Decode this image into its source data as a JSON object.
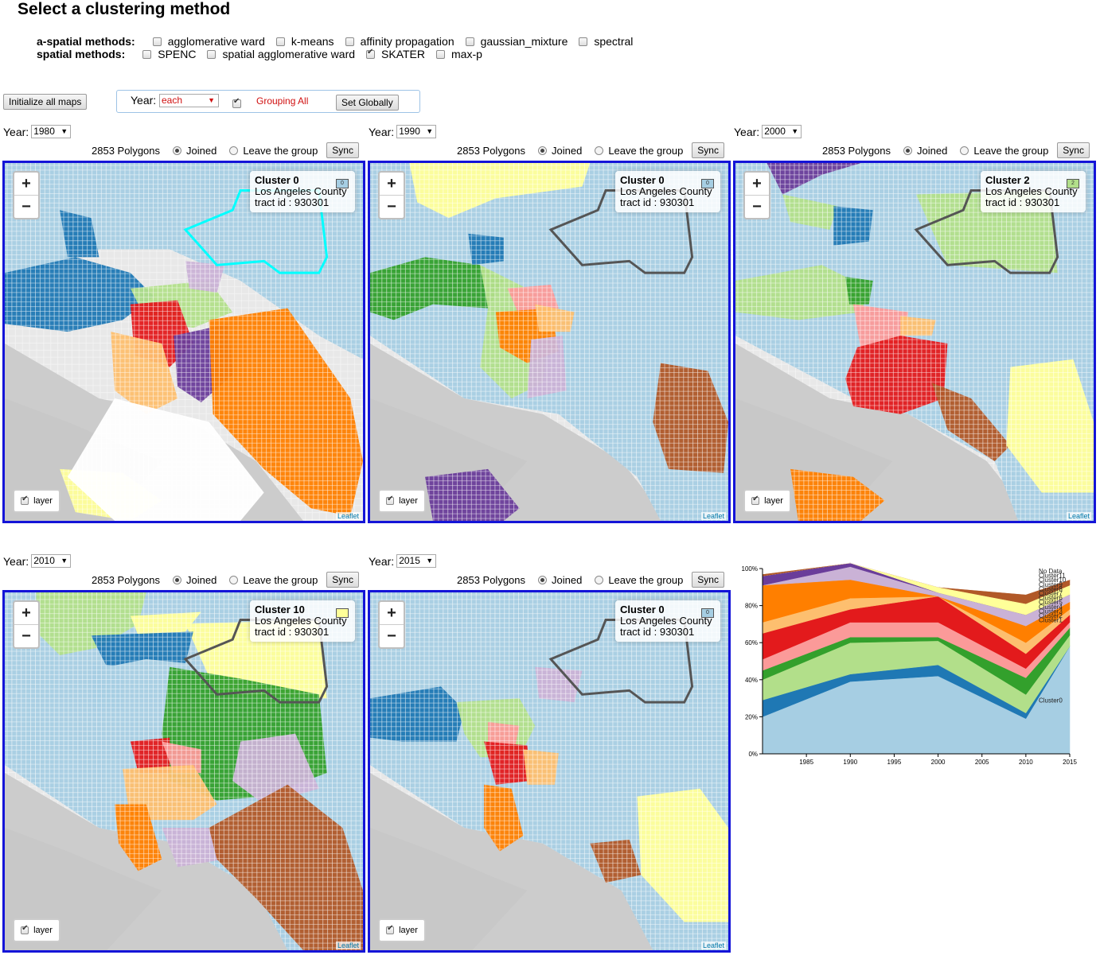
{
  "page_title": "Select a clustering method",
  "aspatial": {
    "label": "a-spatial methods:",
    "options": [
      {
        "label": "agglomerative ward",
        "checked": false
      },
      {
        "label": "k-means",
        "checked": false
      },
      {
        "label": "affinity propagation",
        "checked": false
      },
      {
        "label": "gaussian_mixture",
        "checked": false
      },
      {
        "label": "spectral",
        "checked": false
      }
    ]
  },
  "spatial": {
    "label": "spatial methods:",
    "options": [
      {
        "label": "SPENC",
        "checked": false
      },
      {
        "label": "spatial agglomerative ward",
        "checked": false
      },
      {
        "label": "SKATER",
        "checked": true
      },
      {
        "label": "max-p",
        "checked": false
      }
    ]
  },
  "init_button": "Initialize all maps",
  "global": {
    "year_label": "Year:",
    "year_value": "each",
    "grouping_label": "Grouping All",
    "grouping_checked": true,
    "set_button": "Set Globally"
  },
  "common": {
    "year_label": "Year:",
    "polygons": "2853 Polygons",
    "joined": "Joined",
    "leave": "Leave the group",
    "sync": "Sync",
    "zoom_in": "+",
    "zoom_out": "−",
    "layer": "layer",
    "attribution": "Leaflet"
  },
  "maps": [
    {
      "year": "1980",
      "cluster": "Cluster 0",
      "swatch_label": "0",
      "swatch_color": "#a6cee3",
      "county": "Los Angeles County",
      "tract": "tract id : 930301"
    },
    {
      "year": "1990",
      "cluster": "Cluster 0",
      "swatch_label": "0",
      "swatch_color": "#a6cee3",
      "county": "Los Angeles County",
      "tract": "tract id : 930301"
    },
    {
      "year": "2000",
      "cluster": "Cluster 2",
      "swatch_label": "2",
      "swatch_color": "#b2df8a",
      "county": "Los Angeles County",
      "tract": "tract id : 930301"
    },
    {
      "year": "2010",
      "cluster": "Cluster 10",
      "swatch_label": "",
      "swatch_color": "#ffff99",
      "county": "Los Angeles County",
      "tract": "tract id : 930301"
    },
    {
      "year": "2015",
      "cluster": "Cluster 0",
      "swatch_label": "0",
      "swatch_color": "#a6cee3",
      "county": "Los Angeles County",
      "tract": "tract id : 930301"
    }
  ],
  "chart_data": {
    "type": "area",
    "stacked": true,
    "x": [
      1980,
      1990,
      2000,
      2010,
      2015
    ],
    "x_ticks": [
      "1985",
      "1990",
      "1995",
      "2000",
      "2005",
      "2010",
      "2015"
    ],
    "y_ticks": [
      "0%",
      "20%",
      "40%",
      "60%",
      "80%",
      "100%"
    ],
    "ylim": [
      0,
      100
    ],
    "series": [
      {
        "name": "Cluster0",
        "color": "#a6cee3",
        "values": [
          20,
          39,
          42,
          19,
          58
        ]
      },
      {
        "name": "Cluster1",
        "color": "#1f78b4",
        "values": [
          9,
          4,
          6,
          3,
          0
        ]
      },
      {
        "name": "Cluster2",
        "color": "#b2df8a",
        "values": [
          11,
          17,
          13,
          10,
          6
        ]
      },
      {
        "name": "Cluster3",
        "color": "#33a02c",
        "values": [
          5,
          3,
          2,
          9,
          4
        ]
      },
      {
        "name": "Cluster4",
        "color": "#fb9a99",
        "values": [
          6,
          8,
          8,
          5,
          3
        ]
      },
      {
        "name": "Cluster5",
        "color": "#e31a1c",
        "values": [
          14,
          7,
          14,
          8,
          4
        ]
      },
      {
        "name": "Cluster6",
        "color": "#fdbf6f",
        "values": [
          6,
          6,
          0,
          6,
          3
        ]
      },
      {
        "name": "Cluster7",
        "color": "#ff7f00",
        "values": [
          20,
          10,
          0,
          9,
          4
        ]
      },
      {
        "name": "Cluster8",
        "color": "#cab2d6",
        "values": [
          0,
          7,
          2,
          6,
          4
        ]
      },
      {
        "name": "Cluster9",
        "color": "#6a3d9a",
        "values": [
          5,
          2,
          0,
          0,
          0
        ]
      },
      {
        "name": "Cluster10",
        "color": "#ffff99",
        "values": [
          0,
          0,
          3,
          6,
          5
        ]
      },
      {
        "name": "Cluster11",
        "color": "#b15928",
        "values": [
          1,
          0,
          0,
          5,
          3
        ]
      },
      {
        "name": "No Data",
        "color": "#ffffff",
        "values": [
          3,
          0,
          1,
          4,
          4
        ]
      }
    ]
  }
}
